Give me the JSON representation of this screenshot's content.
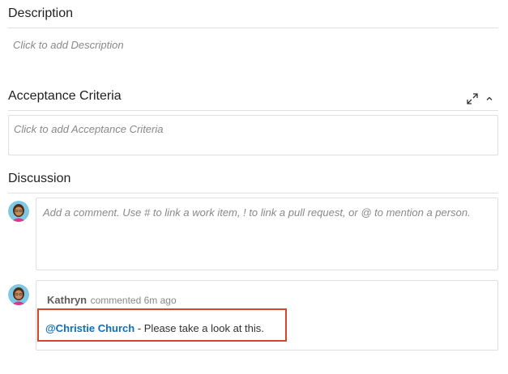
{
  "description": {
    "title": "Description",
    "placeholder": "Click to add Description"
  },
  "acceptance": {
    "title": "Acceptance Criteria",
    "placeholder": "Click to add Acceptance Criteria",
    "expand_icon": "expand-icon",
    "collapse_icon": "chevron-up-icon"
  },
  "discussion": {
    "title": "Discussion",
    "comment_placeholder": "Add a comment. Use # to link a work item, ! to link a pull request, or @ to mention a person.",
    "comments": [
      {
        "author": "Kathryn",
        "meta": "commented 6m ago",
        "mention": "@Christie Church",
        "text": " - Please take a look at this."
      }
    ]
  },
  "colors": {
    "highlight_border": "#d9452c",
    "mention": "#106ebe",
    "divider": "#e1dfdd"
  }
}
